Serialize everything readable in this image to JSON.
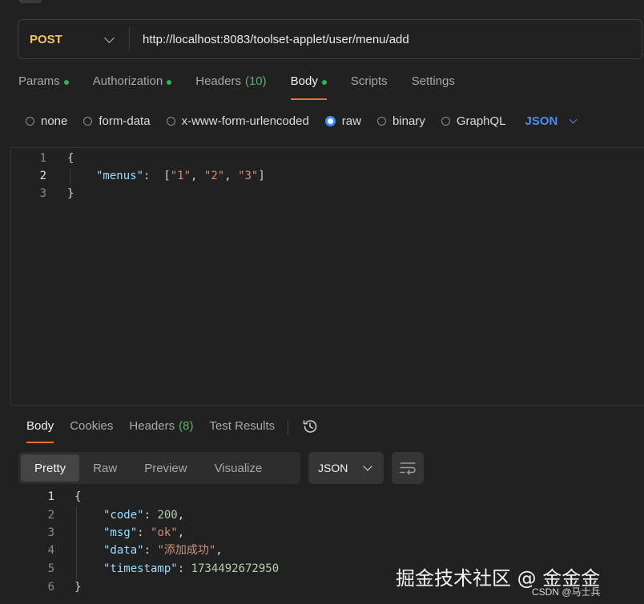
{
  "request": {
    "method": "POST",
    "url": "http://localhost:8083/toolset-applet/user/menu/add"
  },
  "request_tabs": [
    {
      "label": "Params",
      "dot": true
    },
    {
      "label": "Authorization",
      "dot": true
    },
    {
      "label": "Headers",
      "count": "(10)"
    },
    {
      "label": "Body",
      "dot": true,
      "active": true
    },
    {
      "label": "Scripts"
    },
    {
      "label": "Settings"
    }
  ],
  "body_types": [
    {
      "label": "none",
      "selected": false
    },
    {
      "label": "form-data",
      "selected": false
    },
    {
      "label": "x-www-form-urlencoded",
      "selected": false
    },
    {
      "label": "raw",
      "selected": true
    },
    {
      "label": "binary",
      "selected": false
    },
    {
      "label": "GraphQL",
      "selected": false
    }
  ],
  "body_format": "JSON",
  "request_body": {
    "line_numbers": [
      "1",
      "2",
      "3"
    ],
    "open_brace": "{",
    "key": "\"menus\"",
    "colon": ":",
    "bracket_open": "[",
    "items": [
      "\"1\"",
      "\"2\"",
      "\"3\""
    ],
    "bracket_close": "]",
    "close_brace": "}"
  },
  "response_tabs": [
    {
      "label": "Body",
      "active": true
    },
    {
      "label": "Cookies"
    },
    {
      "label": "Headers",
      "count": "(8)"
    },
    {
      "label": "Test Results"
    }
  ],
  "view_modes": [
    "Pretty",
    "Raw",
    "Preview",
    "Visualize"
  ],
  "response_format": "JSON",
  "response_body": {
    "line_numbers": [
      "1",
      "2",
      "3",
      "4",
      "5",
      "6"
    ],
    "open_brace": "{",
    "close_brace": "}",
    "fields": [
      {
        "key": "\"code\"",
        "value": "200",
        "type": "num",
        "comma": ","
      },
      {
        "key": "\"msg\"",
        "value": "\"ok\"",
        "type": "str",
        "comma": ","
      },
      {
        "key": "\"data\"",
        "value": "\"添加成功\"",
        "type": "str",
        "comma": ","
      },
      {
        "key": "\"timestamp\"",
        "value": "1734492672950",
        "type": "num",
        "comma": ""
      }
    ]
  },
  "watermark": {
    "main": "掘金技术社区 @ 金金金",
    "sub": "CSDN @马士兵"
  },
  "colors": {
    "background": "#212121",
    "method": "#f2c464",
    "accent_tab": "#ff6c37",
    "dot_green": "#2fb44a",
    "link_blue": "#4a8cf0",
    "json_key": "#9cdcfe",
    "json_string": "#ce9178",
    "json_number": "#b5cea8"
  },
  "icons": [
    "chevron-down-icon",
    "history-icon",
    "wrap-lines-icon"
  ]
}
